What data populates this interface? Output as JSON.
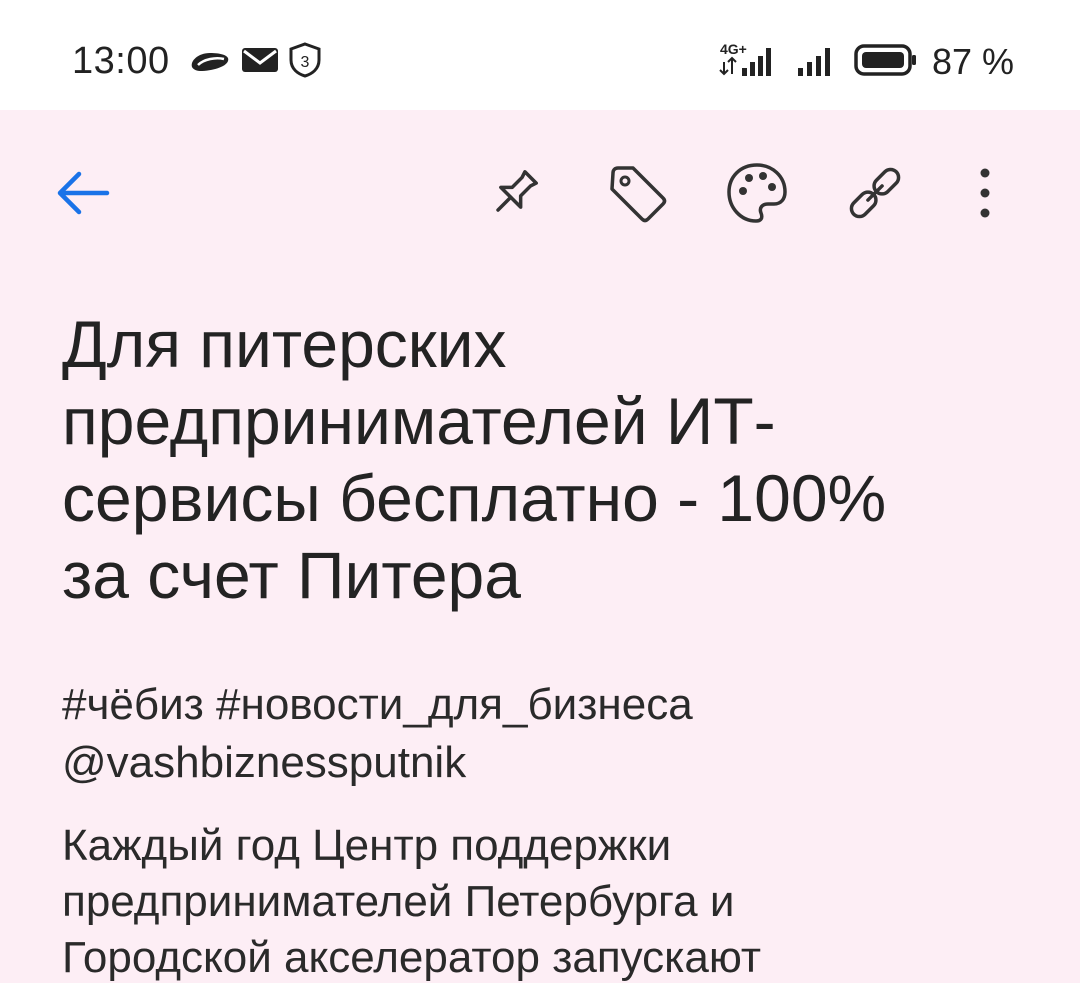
{
  "status_bar": {
    "time": "13:00",
    "battery_percent": "87 %",
    "network_label": "4G+",
    "notification_badge": "3",
    "icons": [
      "cloud-icon",
      "mail-icon",
      "shield-badge-icon",
      "signal-4g-icon",
      "signal-icon",
      "battery-icon"
    ]
  },
  "toolbar": {
    "icons": [
      "back-arrow-icon",
      "pin-icon",
      "label-icon",
      "palette-icon",
      "link-icon",
      "more-vert-icon"
    ],
    "accent_color": "#1a73e8"
  },
  "note": {
    "title_lines": [
      "Для питерских",
      "предпринимателей ИТ-",
      "сервисы бесплатно - 100%",
      "за счет Питера"
    ],
    "tag_lines": [
      "#чёбиз #новости_для_бизнеса",
      "@vashbiznessputnik"
    ],
    "body_lines": [
      "Каждый год Центр поддержки",
      "предпринимателей Петербурга и",
      "Городской акселератор запускают"
    ],
    "background_color": "#fdeef5"
  }
}
